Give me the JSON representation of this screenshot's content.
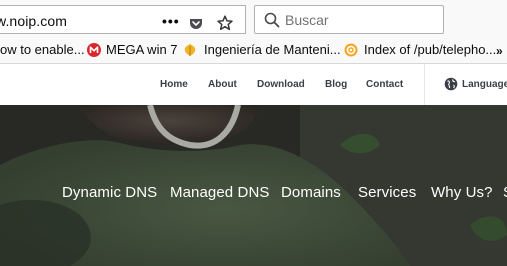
{
  "browser": {
    "url": "w.noip.com",
    "page_actions_label": "•••",
    "search_placeholder": "Buscar"
  },
  "bookmarks": {
    "items": [
      {
        "label": "ow to enable...",
        "icon": "none"
      },
      {
        "label": "MEGA win 7",
        "icon": "mega-icon"
      },
      {
        "label": "Ingeniería de Manteni...",
        "icon": "leaf-icon"
      },
      {
        "label": "Index of /pub/telepho...",
        "icon": "gear-icon"
      }
    ],
    "overflow_label": "»"
  },
  "site_header": {
    "nav": [
      "Home",
      "About",
      "Download",
      "Blog",
      "Contact"
    ],
    "language_label": "Language"
  },
  "hero": {
    "nav": [
      "Dynamic DNS",
      "Managed DNS",
      "Domains",
      "Services",
      "Why Us?",
      "S"
    ]
  },
  "colors": {
    "toolbar_bg": "#f9f9fa",
    "header_text": "#3a3f45",
    "hero_overlay": "#2f322d",
    "hero_text": "#ffffff"
  }
}
